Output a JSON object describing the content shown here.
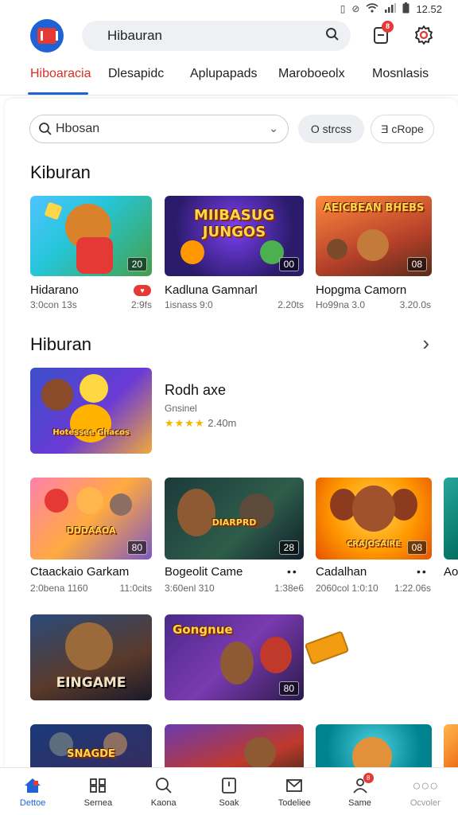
{
  "status": {
    "time": "12.52"
  },
  "header": {
    "search_value": "Hibauran",
    "notification_count": "8"
  },
  "tabs": [
    {
      "label": "Hiboaracia",
      "active": true
    },
    {
      "label": "Dlesapidc"
    },
    {
      "label": "Aplupapads"
    },
    {
      "label": "Maroboeolx"
    },
    {
      "label": "Mosnlasis"
    }
  ],
  "filter": {
    "dropdown_value": "Hbosan",
    "chip_a": "O strcss",
    "chip_b": "Ǝ cRope"
  },
  "section1": {
    "title": "Kiburan",
    "games": [
      {
        "name": "Hidarano",
        "meta": "3:0con 13s",
        "size": "2:9fs",
        "tag": "20",
        "icon": "red-pill"
      },
      {
        "name": "Kadluna Gamnarl",
        "meta": "1isnass 9:0",
        "size": "2.20ts",
        "tag": "00",
        "art_text": "MIIBASUG JUNGOS"
      },
      {
        "name": "Hopgma Camorn",
        "meta": "Ho99na 3.0",
        "size": "3.20.0s",
        "tag": "08",
        "art_text": "AEICBEAN BHEBS"
      }
    ]
  },
  "section2": {
    "title": "Hiburan",
    "featured": {
      "name": "Rodh axe",
      "sub": "Gnsinel",
      "stars": "★★★★",
      "rating": "2.40m",
      "art_text": "Hotessee Ghacos"
    },
    "games": [
      {
        "name": "Ctaackaio Garkam",
        "meta": "2:0bena 1160",
        "size": "11:0cits",
        "tag": "80",
        "art_text": "DDDAAOA"
      },
      {
        "name": "Bogeolit Came",
        "meta": "3:60enl 310",
        "size": "1:38e6",
        "tag": "28",
        "art_text": "DIARPRD"
      },
      {
        "name": "Cadalhan",
        "meta": "2060col 1:0:10",
        "size": "1:22.06s",
        "tag": "08",
        "art_text": "CRAJOSAIRE"
      },
      {
        "name": "Ao"
      }
    ]
  },
  "section3": {
    "cards": [
      {
        "art_text": "EINGAME"
      },
      {
        "art_text": "Gongnue",
        "tag": "80"
      }
    ]
  },
  "section4": {
    "cards": [
      {
        "art_text": "SNAGDE"
      },
      {
        "art_text": ""
      },
      {
        "art_text": ""
      }
    ]
  },
  "bottom_nav": [
    {
      "label": "Dettoe",
      "icon": "home-icon",
      "active": true
    },
    {
      "label": "Sernea",
      "icon": "grid-icon"
    },
    {
      "label": "Kaona",
      "icon": "search-icon"
    },
    {
      "label": "Soak",
      "icon": "box-icon"
    },
    {
      "label": "Todeliee",
      "icon": "mail-icon"
    },
    {
      "label": "Same",
      "icon": "user-icon",
      "badge": "8"
    },
    {
      "label": "Ocvoler",
      "icon": "more-icon",
      "muted": true
    }
  ],
  "colors": {
    "accent_blue": "#1e63d6",
    "accent_red": "#d93025",
    "star": "#f4b400"
  }
}
